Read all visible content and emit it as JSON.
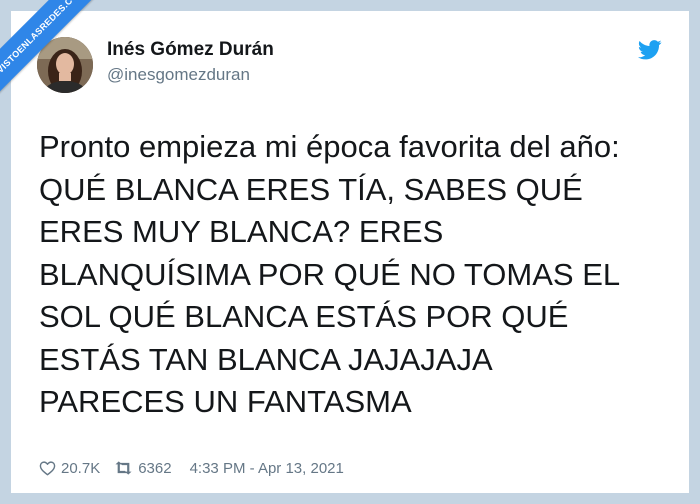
{
  "tweet": {
    "display_name": "Inés Gómez Durán",
    "handle": "@inesgomezduran",
    "text": "Pronto empieza mi época favorita del año:\nQUÉ BLANCA ERES TÍA, SABES QUÉ\nERES MUY BLANCA? ERES\nBLANQUÍSIMA POR QUÉ NO TOMAS EL\nSOL QUÉ BLANCA ESTÁS POR QUÉ\nESTÁS TAN BLANCA JAJAJAJA\nPARECES UN FANTASMA",
    "likes": "20.7K",
    "retweets": "6362",
    "timestamp": "4:33 PM - Apr 13, 2021"
  },
  "watermark": {
    "text": "VISTOENLASREDES.COM"
  },
  "icons": {
    "brand": "twitter-bird-icon",
    "like": "heart-icon",
    "retweet": "retweet-icon"
  },
  "colors": {
    "background": "#c4d4e2",
    "card": "#ffffff",
    "text": "#14171a",
    "secondary_text": "#657786",
    "twitter_blue": "#1da1f2",
    "watermark_blue": "#2f86e8"
  }
}
